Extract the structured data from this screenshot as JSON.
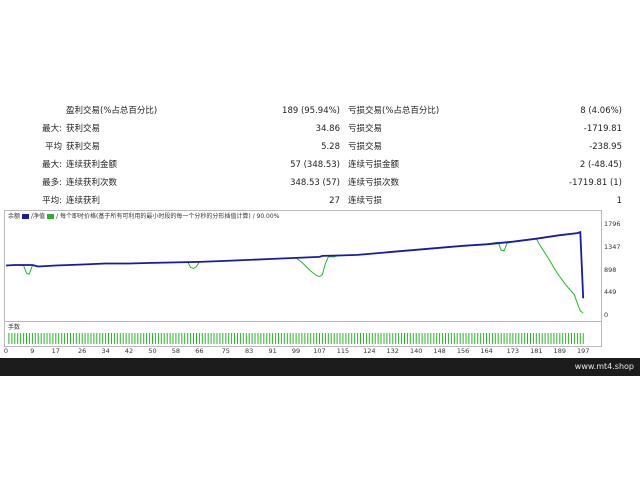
{
  "stats": {
    "rows": [
      {
        "label1": "",
        "name1": "盈利交易(%占总百分比)",
        "value1": "189 (95.94%)",
        "name2": "亏损交易(%占总百分比)",
        "value2": "8 (4.06%)"
      },
      {
        "label1": "最大:",
        "name1": "获利交易",
        "value1": "34.86",
        "name2": "亏损交易",
        "value2": "-1719.81"
      },
      {
        "label1": "平均",
        "name1": "获利交易",
        "value1": "5.28",
        "name2": "亏损交易",
        "value2": "-238.95"
      },
      {
        "label1": "最大:",
        "name1": "连续获利金额",
        "value1": "57 (348.53)",
        "name2": "连续亏损金额",
        "value2": "2 (-48.45)"
      },
      {
        "label1": "最多:",
        "name1": "连续获利次数",
        "value1": "348.53 (57)",
        "name2": "连续亏损次数",
        "value2": "-1719.81 (1)"
      },
      {
        "label1": "平均:",
        "name1": "连续获利",
        "value1": "27",
        "name2": "连续亏损",
        "value2": "1"
      }
    ]
  },
  "chart_data": {
    "type": "line",
    "legend": {
      "balance_label": "余额",
      "equity_label": "净值",
      "note": "每个即时价格(基于所有可利用的最小时段的每一个分秒的分形插值计算) / 90.00%"
    },
    "y_ticks": [
      "1796",
      "1347",
      "898",
      "449",
      "0"
    ],
    "ylim": [
      0,
      1900
    ],
    "x_ticks": [
      "0",
      "9",
      "17",
      "26",
      "34",
      "42",
      "50",
      "58",
      "66",
      "75",
      "83",
      "91",
      "99",
      "107",
      "115",
      "124",
      "132",
      "140",
      "148",
      "156",
      "164",
      "173",
      "181",
      "189",
      "197"
    ],
    "xlim": [
      0,
      200
    ],
    "series": [
      {
        "name": "余额",
        "color": "#1a1aa8",
        "x": [
          0,
          3,
          9,
          11,
          17,
          26,
          34,
          42,
          50,
          58,
          66,
          75,
          83,
          91,
          99,
          107,
          108,
          115,
          120,
          124,
          132,
          140,
          148,
          156,
          164,
          173,
          181,
          189,
          195,
          196,
          197
        ],
        "y": [
          1000,
          1010,
          1010,
          980,
          1000,
          1020,
          1040,
          1040,
          1050,
          1060,
          1070,
          1090,
          1110,
          1130,
          1150,
          1170,
          1190,
          1200,
          1210,
          1230,
          1270,
          1310,
          1350,
          1390,
          1420,
          1470,
          1530,
          1600,
          1640,
          1660,
          350
        ]
      },
      {
        "name": "净值",
        "color": "#28b428",
        "x": [
          0,
          3,
          6,
          7,
          8,
          9,
          11,
          17,
          26,
          34,
          42,
          50,
          58,
          62,
          63,
          64,
          65,
          66,
          75,
          83,
          91,
          99,
          101,
          104,
          106,
          107,
          108,
          109,
          110,
          112,
          113,
          115,
          120,
          124,
          132,
          140,
          148,
          156,
          164,
          168,
          169,
          170,
          171,
          173,
          181,
          182,
          185,
          188,
          191,
          194,
          195,
          196,
          197
        ],
        "y": [
          1000,
          1010,
          1000,
          850,
          830,
          1000,
          980,
          1000,
          1020,
          1040,
          1040,
          1050,
          1060,
          1070,
          960,
          940,
          980,
          1070,
          1090,
          1110,
          1130,
          1150,
          1060,
          890,
          800,
          780,
          820,
          1040,
          1170,
          1170,
          1190,
          1200,
          1210,
          1230,
          1270,
          1310,
          1350,
          1390,
          1420,
          1460,
          1300,
          1290,
          1440,
          1470,
          1530,
          1420,
          1150,
          860,
          620,
          420,
          250,
          100,
          60
        ]
      }
    ],
    "volume": {
      "label": "手数",
      "x_start": 1,
      "x_end": 197,
      "level": 0.5
    }
  },
  "footer": {
    "text": "www.mt4.shop"
  }
}
